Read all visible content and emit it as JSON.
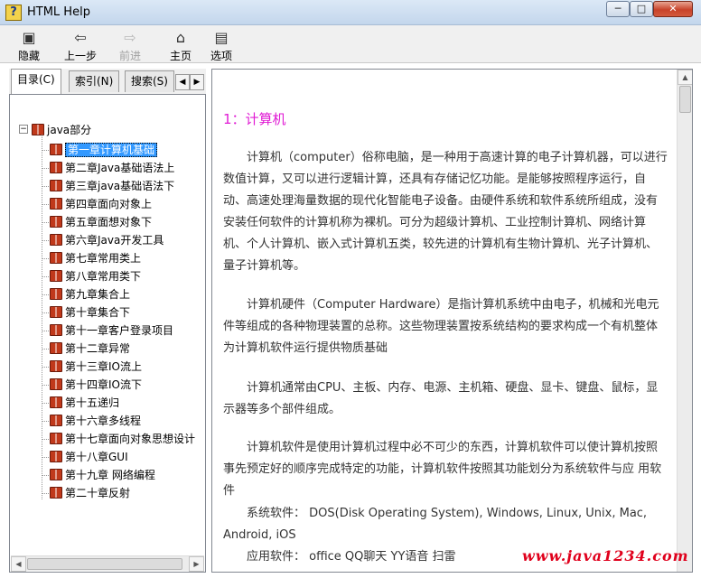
{
  "window": {
    "title": "HTML Help",
    "min": "─",
    "max": "□",
    "close": "✕"
  },
  "toolbar": [
    {
      "icon": "hide-icon",
      "label": "隐藏",
      "glyph": "▣",
      "enabled": true
    },
    {
      "icon": "back-icon",
      "label": "上一步",
      "glyph": "⇦",
      "enabled": true
    },
    {
      "icon": "forward-icon",
      "label": "前进",
      "glyph": "⇨",
      "enabled": false
    },
    {
      "icon": "home-icon",
      "label": "主页",
      "glyph": "⌂",
      "enabled": true
    },
    {
      "icon": "options-icon",
      "label": "选项",
      "glyph": "▤",
      "enabled": true
    }
  ],
  "tabs": {
    "contents": "目录(C)",
    "index": "索引(N)",
    "search": "搜索(S)"
  },
  "tree": {
    "root": "java部分",
    "items": [
      "第一章计算机基础",
      "第二章Java基础语法上",
      "第三章java基础语法下",
      "第四章面向对象上",
      "第五章面想对象下",
      "第六章Java开发工具",
      "第七章常用类上",
      "第八章常用类下",
      "第九章集合上",
      "第十章集合下",
      "第十一章客户登录项目",
      "第十二章异常",
      "第十三章IO流上",
      "第十四章IO流下",
      "第十五递归",
      "第十六章多线程",
      "第十七章面向对象思想设计",
      "第十八章GUI",
      "第十九章 网络编程",
      "第二十章反射"
    ],
    "selected": 0
  },
  "content": {
    "heading": "1：计算机",
    "p1": "　　计算机（computer）俗称电脑，是一种用于高速计算的电子计算机器，可以进行数值计算，又可以进行逻辑计算，还具有存储记忆功能。是能够按照程序运行，自动、高速处理海量数据的现代化智能电子设备。由硬件系统和软件系统所组成，没有安装任何软件的计算机称为裸机。可分为超级计算机、工业控制计算机、网络计算机、个人计算机、嵌入式计算机五类，较先进的计算机有生物计算机、光子计算机、量子计算机等。",
    "p2": "　　计算机硬件（Computer Hardware）是指计算机系统中由电子，机械和光电元件等组成的各种物理装置的总称。这些物理装置按系统结构的要求构成一个有机整体为计算机软件运行提供物质基础",
    "p3": "　　计算机通常由CPU、主板、内存、电源、主机箱、硬盘、显卡、键盘、鼠标，显示器等多个部件组成。",
    "p4": "　　计算机软件是使用计算机过程中必不可少的东西，计算机软件可以使计算机按照事先预定好的顺序完成特定的功能，计算机软件按照其功能划分为系统软件与应 用软件",
    "p5": "　　系统软件： DOS(Disk Operating System), Windows, Linux, Unix, Mac, Android, iOS",
    "p6": "　　应用软件： office QQ聊天 YY语音 扫雷"
  },
  "watermark": "www.java1234.com"
}
